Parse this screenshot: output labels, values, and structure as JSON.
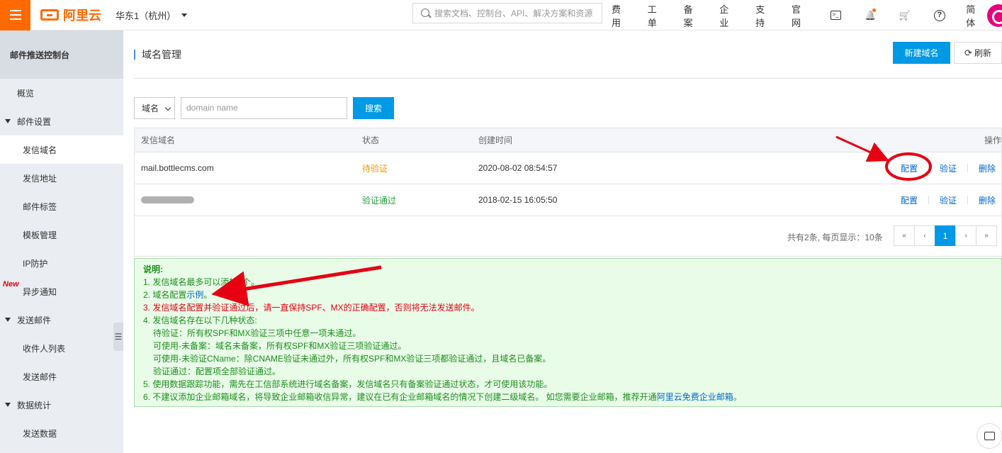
{
  "topbar": {
    "brand": "阿里云",
    "region": "华东1（杭州）",
    "search_placeholder": "搜索文档、控制台、API、解决方案和资源",
    "nav": [
      "费用",
      "工单",
      "备案",
      "企业",
      "支持",
      "官网"
    ],
    "lang": "简体",
    "terminal_glyph": ">_",
    "help_glyph": "?",
    "bell_glyph": "🔔",
    "cart_glyph": "🛒"
  },
  "sidebar": {
    "title": "邮件推送控制台",
    "items": [
      {
        "label": "概览",
        "level": 0,
        "active": false
      },
      {
        "label": "邮件设置",
        "level": "group",
        "active": false
      },
      {
        "label": "发信域名",
        "level": 1,
        "active": true
      },
      {
        "label": "发信地址",
        "level": 1,
        "active": false
      },
      {
        "label": "邮件标签",
        "level": 1,
        "active": false
      },
      {
        "label": "模板管理",
        "level": 1,
        "active": false
      },
      {
        "label": "IP防护",
        "level": 1,
        "active": false
      },
      {
        "label": "异步通知",
        "level": 1,
        "active": false,
        "badge": "New"
      },
      {
        "label": "发送邮件",
        "level": "group",
        "active": false
      },
      {
        "label": "收件人列表",
        "level": 1,
        "active": false
      },
      {
        "label": "发送邮件",
        "level": 1,
        "active": false
      },
      {
        "label": "数据统计",
        "level": "group",
        "active": false
      },
      {
        "label": "发送数据",
        "level": 1,
        "active": false
      }
    ]
  },
  "main": {
    "page_title": "域名管理",
    "new_button": "新建域名",
    "refresh_button": "刷新",
    "refresh_icon": "⟳",
    "filter": {
      "select_value": "域名",
      "input_placeholder": "domain name",
      "search_button": "搜索"
    },
    "table": {
      "headers": [
        "发信域名",
        "状态",
        "创建时间",
        "操作"
      ],
      "rows": [
        {
          "domain": "mail.bottlecms.com",
          "status": "待验证",
          "created": "2020-08-02 08:54:57",
          "ops": [
            "配置",
            "验证",
            "删除"
          ]
        },
        {
          "domain": "",
          "status": "验证通过",
          "created": "2018-02-15 16:05:50",
          "ops": [
            "配置",
            "验证",
            "删除"
          ]
        }
      ]
    },
    "pager": {
      "summary": "共有2条, 每页显示：10条",
      "first": "«",
      "prev": "‹",
      "current": "1",
      "next": "›",
      "last": "»"
    },
    "notes": {
      "heading": "说明:",
      "line1": "1. 发信域名最多可以添加5个。",
      "line2_prefix": "2. 域名配置",
      "line2_link": "示例",
      "line2_suffix": "。",
      "line3": "3. 发信域名配置并验证通过后，请一直保持SPF、MX的正确配置，否则将无法发送邮件。",
      "line4": "4. 发信域名存在以下几种状态:",
      "line4a": "待验证：所有权SPF和MX验证三项中任意一项未通过。",
      "line4b": "可使用-未备案：域名未备案，所有权SPF和MX验证三项验证通过。",
      "line4c": "可使用-未验证CName：除CNAME验证未通过外，所有权SPF和MX验证三项都验证通过，且域名已备案。",
      "line4d": "验证通过：配置项全部验证通过。",
      "line5": "5. 使用数据跟踪功能，需先在工信部系统进行域名备案，发信域名只有备案验证通过状态，才可使用该功能。",
      "line6_prefix": "6. 不建议添加企业邮箱域名，将导致企业邮箱收信异常，建议在已有企业邮箱域名的情况下创建二级域名。 如您需要企业邮箱，推荐开通",
      "line6_link": "阿里云免费企业邮箱",
      "line6_suffix": "。"
    }
  },
  "colors": {
    "brand": "#ff6a00",
    "primary": "#0099e6",
    "annotation": "#e60012"
  }
}
